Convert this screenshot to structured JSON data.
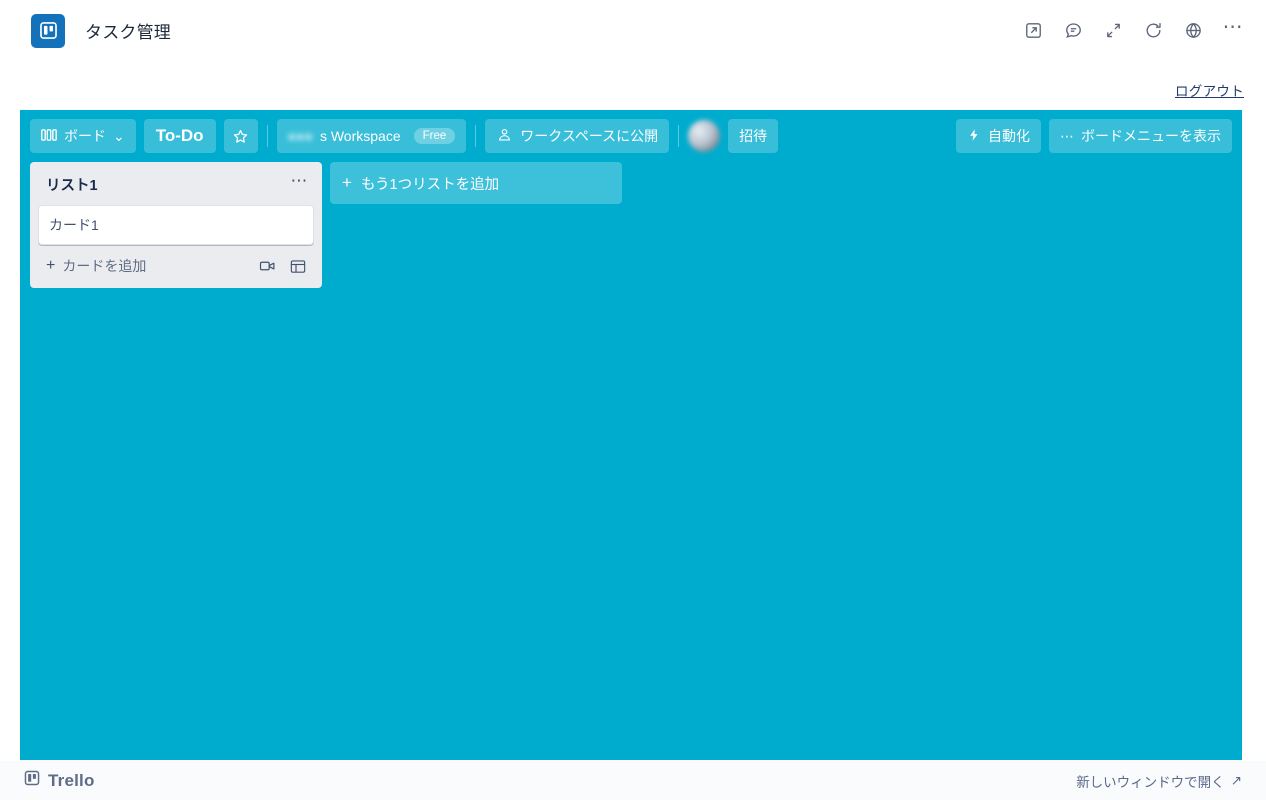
{
  "app_header": {
    "title": "タスク管理",
    "logo_icon": "trello-board-icon",
    "icons": [
      {
        "name": "open-external-icon",
        "label": "新しいウィンドウで開く"
      },
      {
        "name": "feedback-comment-icon",
        "label": "フィードバック"
      },
      {
        "name": "collapse-arrows-icon",
        "label": "縮小"
      },
      {
        "name": "refresh-icon",
        "label": "再読み込み"
      },
      {
        "name": "globe-icon",
        "label": "言語"
      },
      {
        "name": "more-options-icon",
        "label": "…"
      }
    ]
  },
  "logout": {
    "label": "ログアウト"
  },
  "board_bar": {
    "boards_button": {
      "label": "ボード",
      "icon": "boards-icon",
      "chevron": "⌄"
    },
    "board_name": "To-Do",
    "star_icon": "star-icon",
    "workspace": {
      "name_redacted": "●●●",
      "name_suffix": "s Workspace",
      "plan_badge": "Free"
    },
    "visibility_button": {
      "label": "ワークスペースに公開",
      "icon": "workspace-visibility-icon"
    },
    "avatar": {
      "name": "member-avatar",
      "redacted": true
    },
    "invite_button": {
      "label": "招待"
    },
    "automation_button": {
      "label": "自動化",
      "icon": "lightning-bolt-icon"
    },
    "board_menu_button": {
      "label": "ボードメニューを表示",
      "icon": "ellipsis-icon"
    }
  },
  "board": {
    "background_color": "#00acce",
    "lists": [
      {
        "title": "リスト1",
        "menu_icon": "list-menu-icon",
        "cards": [
          {
            "title": "カード1"
          }
        ],
        "add_card_label": "カードを追加",
        "add_card_plus": "+",
        "trailing_icons": [
          {
            "name": "video-camera-icon"
          },
          {
            "name": "card-template-icon"
          }
        ]
      }
    ],
    "add_list": {
      "label": "もう1つリストを追加",
      "plus": "+"
    }
  },
  "footer": {
    "brand": "Trello",
    "brand_icon": "trello-board-icon",
    "open_new_window": {
      "label": "新しいウィンドウで開く",
      "arrow": "↗"
    }
  },
  "colors": {
    "board_bg": "#00acce",
    "list_bg": "#ebecf0",
    "logo_blue": "#1472bb",
    "text_dark": "#172b4d",
    "text_muted": "#5e6c84",
    "link": "#233a6b"
  }
}
